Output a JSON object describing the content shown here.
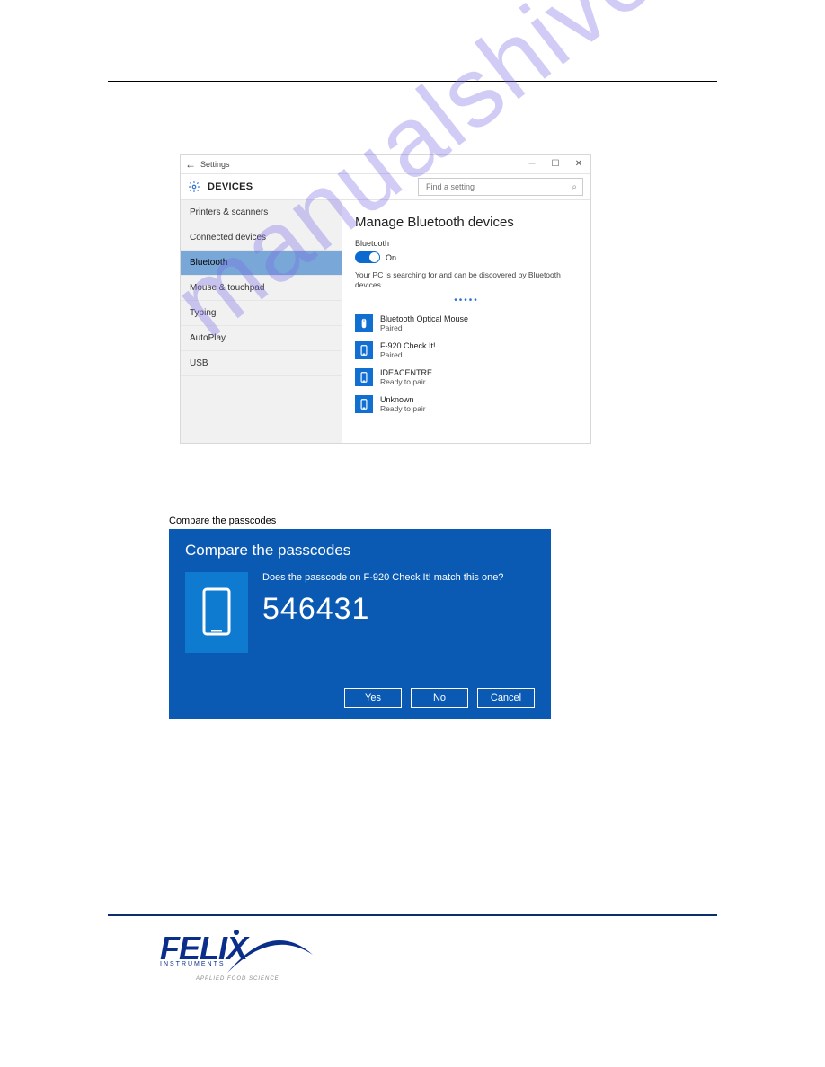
{
  "watermark": "manualshive.com",
  "settings": {
    "window_title": "Settings",
    "header_title": "DEVICES",
    "search_placeholder": "Find a setting",
    "nav_items": [
      "Printers & scanners",
      "Connected devices",
      "Bluetooth",
      "Mouse & touchpad",
      "Typing",
      "AutoPlay",
      "USB"
    ],
    "selected_nav_index": 2,
    "content": {
      "heading": "Manage Bluetooth devices",
      "bluetooth_label": "Bluetooth",
      "toggle_state": "On",
      "discover_text": "Your PC is searching for and can be discovered by Bluetooth devices.",
      "devices": [
        {
          "name": "Bluetooth Optical Mouse",
          "status": "Paired",
          "icon": "mouse"
        },
        {
          "name": "F-920 Check It!",
          "status": "Paired",
          "icon": "phone"
        },
        {
          "name": "IDEACENTRE",
          "status": "Ready to pair",
          "icon": "phone"
        },
        {
          "name": "Unknown",
          "status": "Ready to pair",
          "icon": "phone"
        }
      ]
    }
  },
  "passcode": {
    "caption": "Compare the passcodes",
    "title": "Compare the passcodes",
    "question": "Does the passcode on F-920 Check It! match this one?",
    "code": "546431",
    "buttons": {
      "yes": "Yes",
      "no": "No",
      "cancel": "Cancel"
    }
  },
  "logo": {
    "brand": "FELIX",
    "sub": "INSTRUMENTS",
    "tag": "APPLIED FOOD SCIENCE"
  }
}
